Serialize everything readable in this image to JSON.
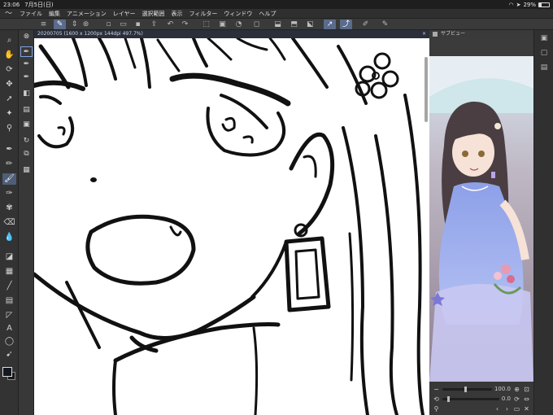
{
  "status_bar": {
    "time": "23:06",
    "date": "7月5日(日)",
    "battery": "29%",
    "battery_level": 0.29
  },
  "menu": {
    "items": [
      "ファイル",
      "編集",
      "アニメーション",
      "レイヤー",
      "選択範囲",
      "表示",
      "フィルター",
      "ウィンドウ",
      "ヘルプ"
    ]
  },
  "document": {
    "tab_title": "20200705 (1600 x 1200px 144dpi 497.7%)",
    "close_glyph": "×"
  },
  "navigator": {
    "title": "サブビュー",
    "zoom": "100.0",
    "rotation": "0.0"
  },
  "colors": {
    "main": "#15181f",
    "sub": "#1a1a1a",
    "accent": "#5a6b8c"
  }
}
